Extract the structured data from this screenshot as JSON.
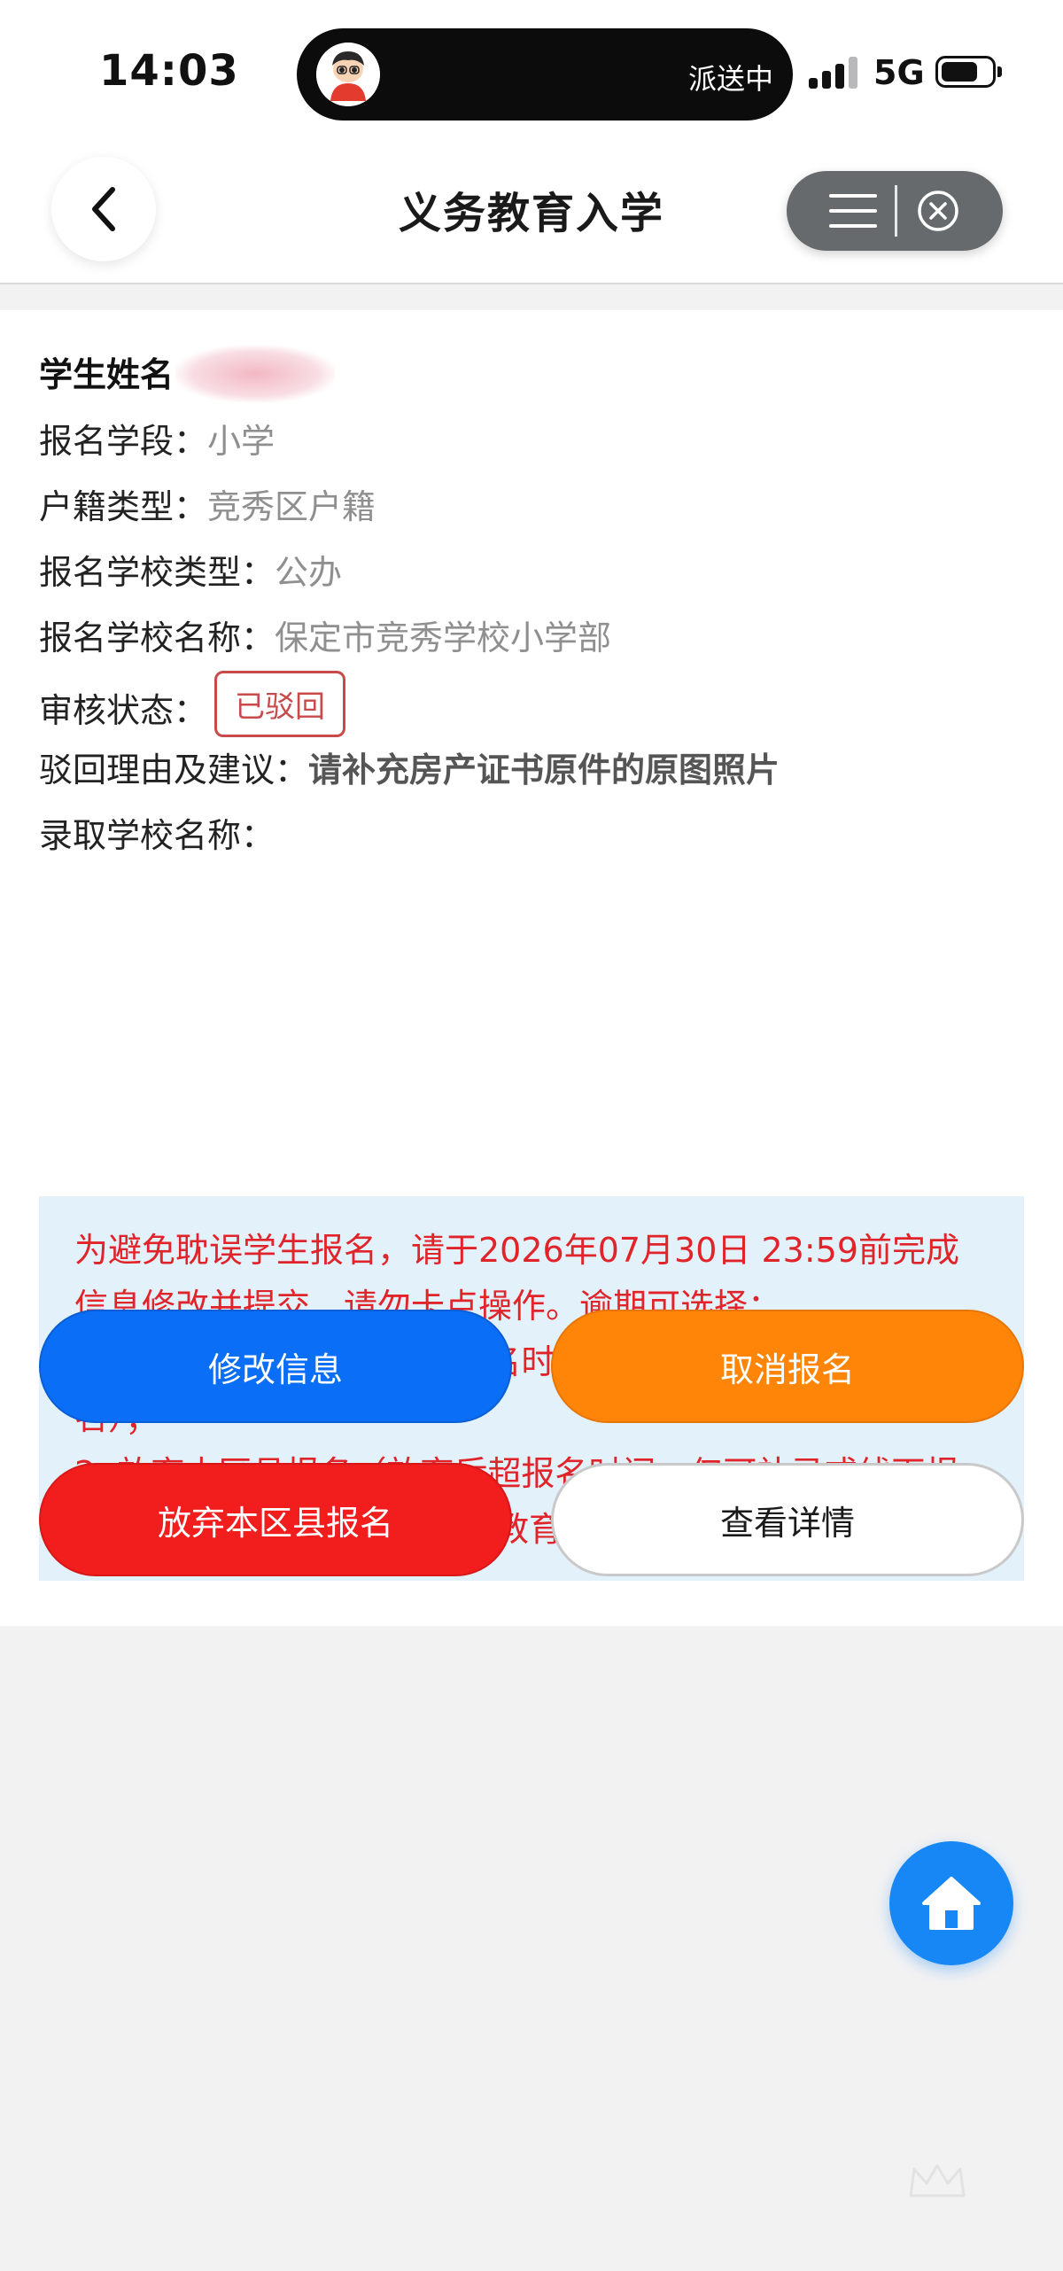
{
  "status_bar": {
    "time": "14:03",
    "island_text": "派送中",
    "network": "5G",
    "signal_bars": 3,
    "signal_bars_total": 4
  },
  "header": {
    "title": "义务教育入学",
    "back_icon": "chevron-left-icon",
    "menu_icon": "menu-icon",
    "close_icon": "close-circle-icon"
  },
  "info": {
    "student_name_label": "学生姓名",
    "stage_label": "报名学段：",
    "stage_value": "小学",
    "household_label": "户籍类型：",
    "household_value": "竞秀区户籍",
    "school_type_label": "报名学校类型：",
    "school_type_value": "公办",
    "school_name_label": "报名学校名称：",
    "school_name_value": "保定市竞秀学校小学部",
    "review_label": "审核状态：",
    "review_value": "已驳回",
    "reject_reason_label": "驳回理由及建议：",
    "reject_reason_value": "请补充房产证书原件的原图照片",
    "admission_label": "录取学校名称："
  },
  "notice": {
    "line1": "为避免耽误学生报名，请于2026年07月30日 23:59前完成",
    "line2": "信息修改并提交，请勿卡点操作。逾期可选择：",
    "line3": "1. 取消报名（取消后若超报名时间，仅可补录或线下报",
    "line4": "名）；",
    "line5": "2. 放弃本区县报名（放弃后超报名时间，仅可补录或线下报",
    "line6": "名）。如有疑问，请咨询当地教育局或片区内学校。"
  },
  "buttons": {
    "edit": "修改信息",
    "cancel": "取消报名",
    "abandon": "放弃本区县报名",
    "detail": "查看详情"
  },
  "colors": {
    "edit": "#0a6ef6",
    "cancel": "#ff8508",
    "abandon": "#f21d1d",
    "notice_text": "#e0242a",
    "notice_bg": "#e3f1fb",
    "fab": "#1687f5"
  },
  "fab_icon": "home-icon"
}
